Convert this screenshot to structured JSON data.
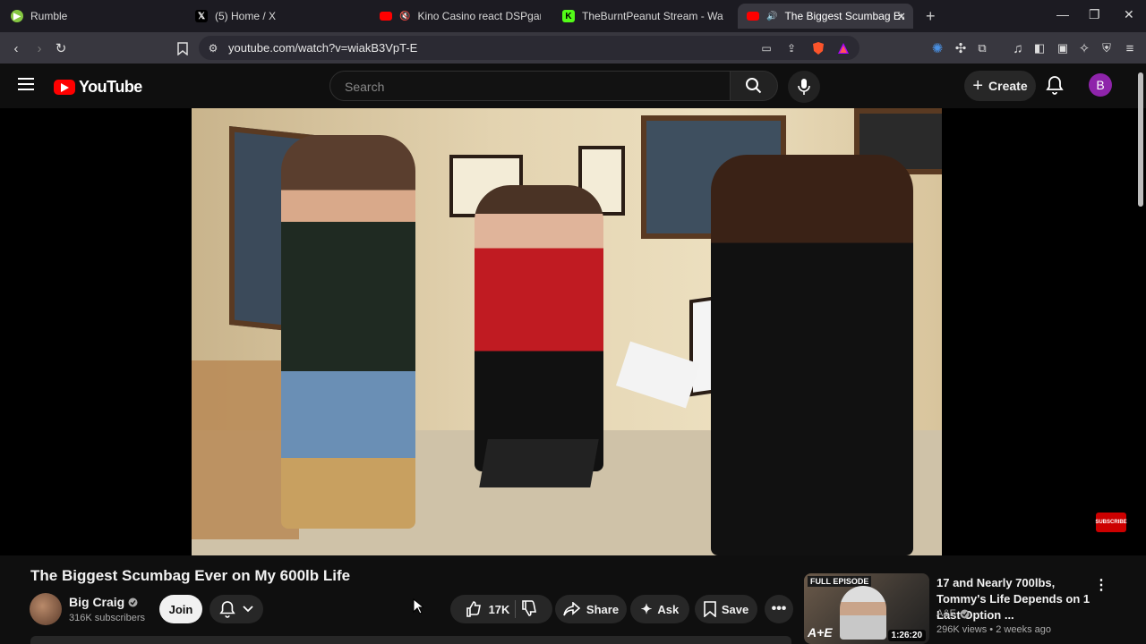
{
  "browser": {
    "tabs": [
      {
        "title": "Rumble",
        "favicon": "rumble-icon",
        "color": "#85c742"
      },
      {
        "title": "(5) Home / X",
        "favicon": "x-icon",
        "color": "#000000"
      },
      {
        "title": "Kino Casino react DSPgamings W",
        "favicon": "youtube-icon",
        "color": "#ff0000"
      },
      {
        "title": "TheBurntPeanut Stream - Watch Live",
        "favicon": "kick-icon",
        "color": "#53fc18"
      },
      {
        "title": "The Biggest Scumbag Ever on",
        "favicon": "youtube-icon",
        "color": "#ff0000",
        "active": true
      }
    ],
    "url": "youtube.com/watch?v=wiakB3VpT-E"
  },
  "youtube": {
    "logo_text": "YouTube",
    "search_placeholder": "Search",
    "create_label": "Create",
    "avatar_letter": "B"
  },
  "video": {
    "title": "The Biggest Scumbag Ever on My 600lb Life",
    "subscribe_badge": "SUBSCRIBE",
    "channel": {
      "name": "Big Craig",
      "subscribers": "316K subscribers",
      "verified": true
    },
    "join_label": "Join",
    "likes": "17K",
    "share_label": "Share",
    "ask_label": "Ask",
    "save_label": "Save"
  },
  "recommended": {
    "title": "17 and Nearly 700lbs, Tommy's Life Depends on 1 Last Option ...",
    "channel": "A&E",
    "meta": "296K views • 2 weeks ago",
    "duration": "1:26:20",
    "thumb_label": "FULL EPISODE",
    "thumb_logo": "A+E"
  }
}
